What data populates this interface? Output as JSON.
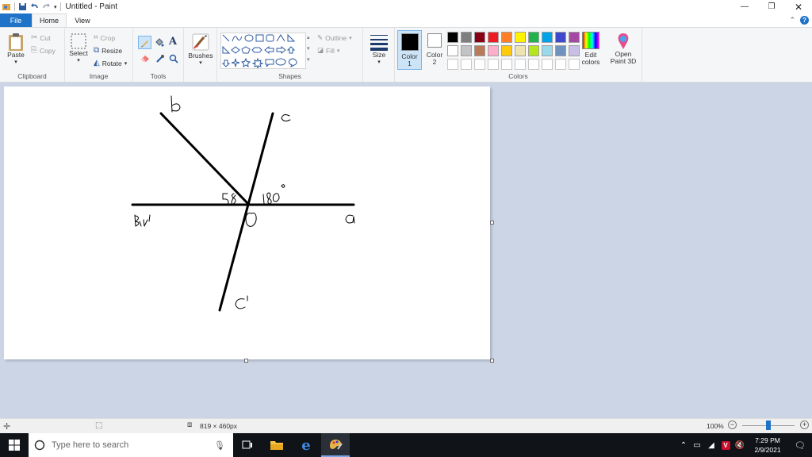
{
  "window": {
    "title": "Untitled - Paint"
  },
  "tabs": [
    {
      "label": "File"
    },
    {
      "label": "Home"
    },
    {
      "label": "View"
    }
  ],
  "clipboard": {
    "paste": "Paste",
    "cut": "Cut",
    "copy": "Copy",
    "group": "Clipboard"
  },
  "image": {
    "select": "Select",
    "crop": "Crop",
    "resize": "Resize",
    "rotate": "Rotate",
    "group": "Image"
  },
  "tools": {
    "group": "Tools"
  },
  "brushes": {
    "label": "Brushes"
  },
  "shapes": {
    "outline": "Outline",
    "fill": "Fill",
    "group": "Shapes"
  },
  "size": {
    "label": "Size"
  },
  "colors": {
    "color1": "Color 1",
    "color2": "Color 2",
    "edit": "Edit colors",
    "paint3d": "Open Paint 3D",
    "group": "Colors",
    "palette_row1": [
      "#000000",
      "#7f7f7f",
      "#880015",
      "#ed1c24",
      "#ff7f27",
      "#fff200",
      "#22b14c",
      "#00a2e8",
      "#3f48cc",
      "#a349a4"
    ],
    "palette_row2": [
      "#ffffff",
      "#c3c3c3",
      "#b97a57",
      "#ffaec9",
      "#ffc90e",
      "#efe4b0",
      "#b5e61d",
      "#99d9ea",
      "#7092be",
      "#c8bfe7"
    ]
  },
  "status": {
    "canvas_size": "819 × 460px",
    "zoom": "100%"
  },
  "taskbar": {
    "search_placeholder": "Type here to search",
    "time": "7:29 PM",
    "date": "2/9/2021"
  }
}
